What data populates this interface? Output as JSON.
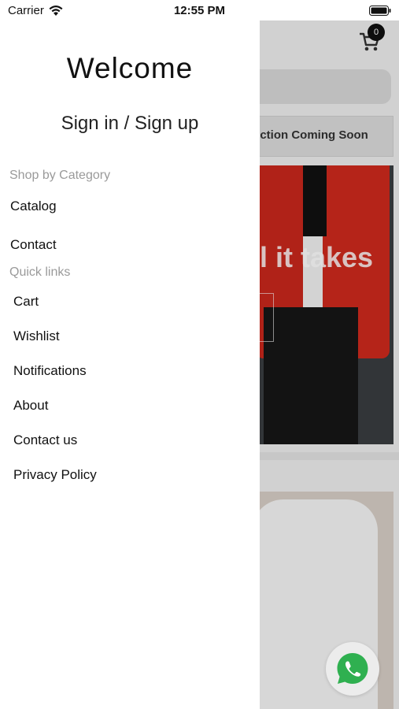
{
  "status_bar": {
    "carrier": "Carrier",
    "time": "12:55 PM"
  },
  "drawer": {
    "welcome": "Welcome",
    "sign_in": "Sign in / Sign up",
    "shop_by_category": "Shop by Category",
    "category_items": [
      "Catalog",
      "Contact"
    ],
    "quick_links_label": "Quick links",
    "quick_links": [
      "Cart",
      "Wishlist",
      "Notifications",
      "About",
      "Contact us",
      "Privacy Policy"
    ]
  },
  "background": {
    "cart_count": "0",
    "banner_text": "ection Coming Soon",
    "hero_text": "l it takes"
  },
  "icons": {
    "wifi": "wifi-icon",
    "battery": "battery-icon",
    "cart": "cart-icon",
    "whatsapp": "whatsapp-icon"
  },
  "colors": {
    "whatsapp_green": "#2fb050",
    "jacket_red": "#cf2a1d"
  }
}
